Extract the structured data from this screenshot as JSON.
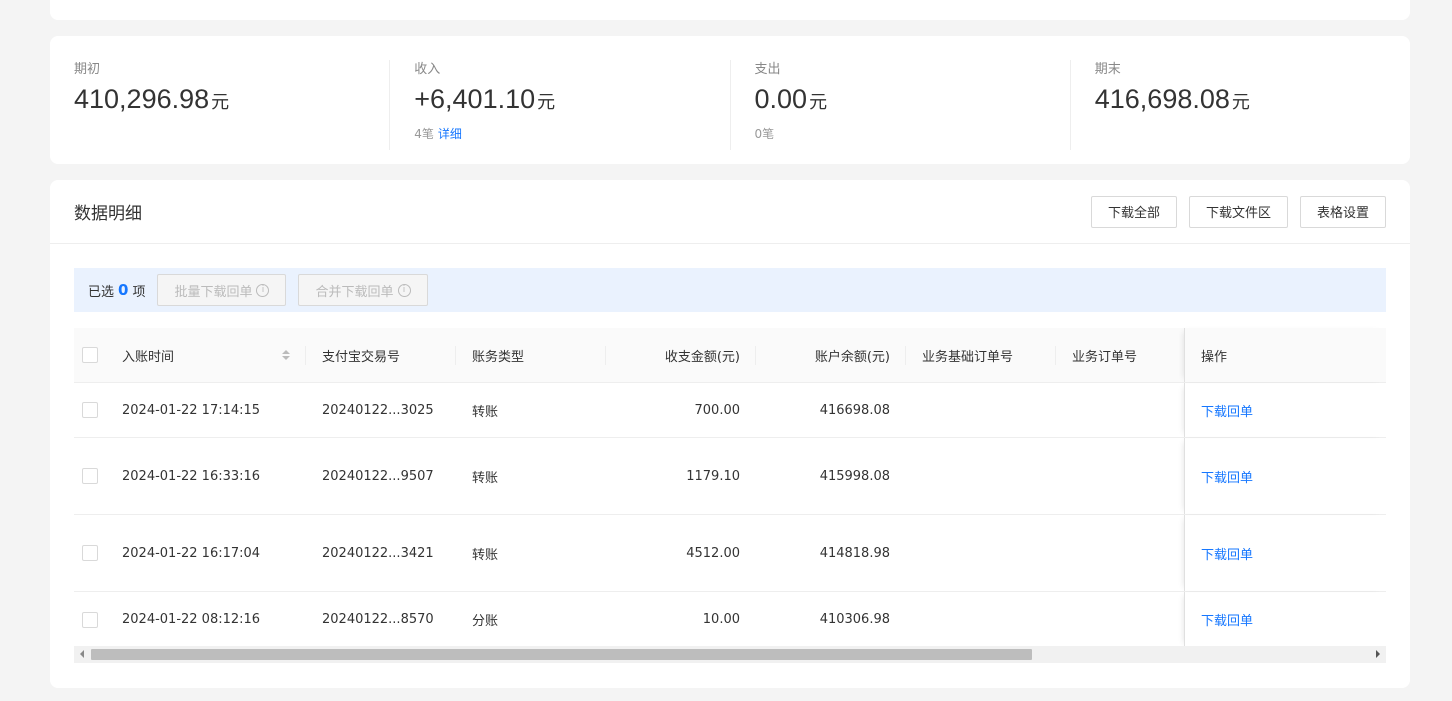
{
  "summary": [
    {
      "label": "期初",
      "value": "410,296.98",
      "unit": "元",
      "sub_count": "",
      "sub_link": ""
    },
    {
      "label": "收入",
      "value": "+6,401.10",
      "unit": "元",
      "sub_count": "4笔",
      "sub_link": "详细"
    },
    {
      "label": "支出",
      "value": "0.00",
      "unit": "元",
      "sub_count": "0笔",
      "sub_link": ""
    },
    {
      "label": "期末",
      "value": "416,698.08",
      "unit": "元",
      "sub_count": "",
      "sub_link": ""
    }
  ],
  "detail": {
    "title": "数据明细",
    "buttons": {
      "download_all": "下载全部",
      "download_files": "下载文件区",
      "table_settings": "表格设置"
    }
  },
  "selection": {
    "prefix": "已选",
    "count": "0",
    "suffix": "项",
    "batch_download": "批量下载回单",
    "merge_download": "合并下载回单"
  },
  "table": {
    "headers": {
      "time": "入账时间",
      "id": "支付宝交易号",
      "type": "账务类型",
      "amount": "收支金额(元)",
      "balance": "账户余额(元)",
      "biz_order": "业务基础订单号",
      "order": "业务订单号",
      "op": "操作"
    },
    "rows": [
      {
        "time": "2024-01-22 17:14:15",
        "id": "20240122...3025",
        "type": "转账",
        "amount": "700.00",
        "balance": "416698.08",
        "biz_order": "",
        "order": "",
        "op": "下载回单"
      },
      {
        "time": "2024-01-22 16:33:16",
        "id": "20240122...9507",
        "type": "转账",
        "amount": "1179.10",
        "balance": "415998.08",
        "biz_order": "",
        "order": "",
        "op": "下载回单"
      },
      {
        "time": "2024-01-22 16:17:04",
        "id": "20240122...3421",
        "type": "转账",
        "amount": "4512.00",
        "balance": "414818.98",
        "biz_order": "",
        "order": "",
        "op": "下载回单"
      },
      {
        "time": "2024-01-22 08:12:16",
        "id": "20240122...8570",
        "type": "分账",
        "amount": "10.00",
        "balance": "410306.98",
        "biz_order": "",
        "order": "",
        "op": "下载回单"
      }
    ]
  },
  "colors": {
    "accent": "#1677ff",
    "selection_bg": "#eaf2fe",
    "page_bg": "#f4f4f4"
  }
}
